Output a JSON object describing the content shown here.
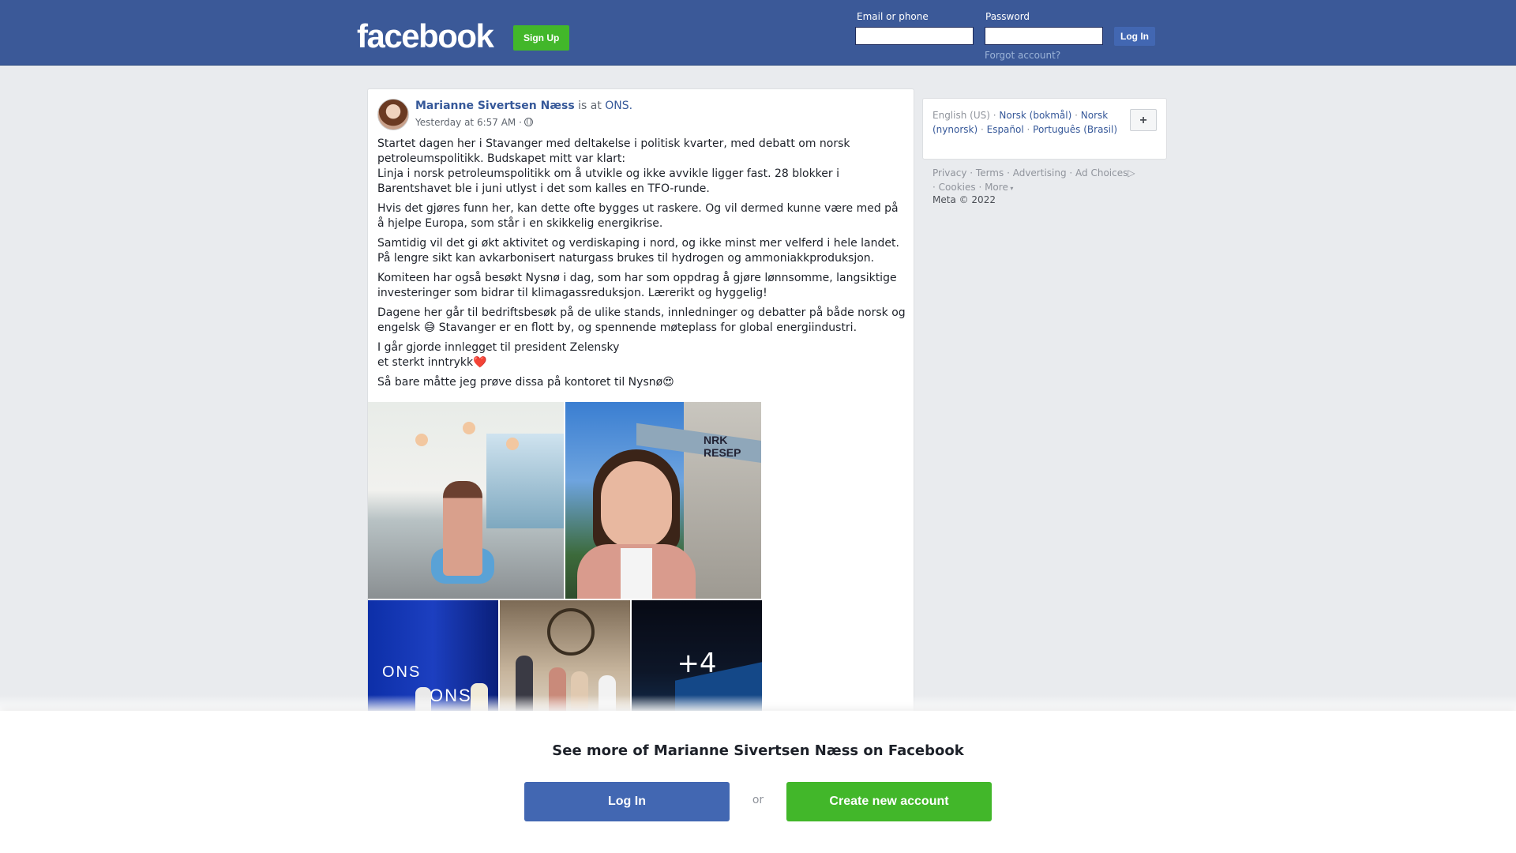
{
  "header": {
    "logo": "facebook",
    "signup_label": "Sign Up",
    "email_label": "Email or phone",
    "password_label": "Password",
    "login_label": "Log In",
    "forgot_label": "Forgot account?"
  },
  "post": {
    "author": "Marianne Sivertsen Næss",
    "is_at": "is at",
    "place": "ONS.",
    "time": "Yesterday at 6:57 AM ·",
    "paragraphs": [
      "Startet dagen her i Stavanger med deltakelse i politisk kvarter, med debatt om norsk petroleumspolitikk. Budskapet mitt var klart:\nLinja i norsk petroleumspolitikk om å utvikle og ikke avvikle ligger fast. 28 blokker i Barentshavet ble i juni utlyst i det som kalles en TFO-runde.",
      "Hvis det gjøres funn her, kan dette ofte bygges ut raskere. Og vil dermed kunne være med på å hjelpe Europa, som står i en skikkelig energikrise.",
      "Samtidig vil det gi økt aktivitet og verdiskaping i nord, og ikke minst mer velferd i hele landet. På lengre sikt kan avkarbonisert naturgass brukes til hydrogen og ammoniakkproduksjon.",
      "Komiteen har også besøkt Nysnø i dag, som har som oppdrag å gjøre lønnsomme, langsiktige investeringer som bidrar til klimagassreduksjon. Lærerikt og hyggelig!",
      "Dagene her går til bedriftsbesøk på de ulike stands, innledninger og debatter på både norsk og engelsk 😅 Stavanger er en flott by, og spennende møteplass for global energiindustri.",
      "I går gjorde innlegget til president Zelensky\net sterkt inntrykk❤️",
      "Så bare måtte jeg prøve dissa på kontoret til Nysnø😍"
    ],
    "photo_more": "+4",
    "photo_signs": {
      "nrk": "NRK RESEP",
      "ons": "ONS"
    }
  },
  "sidebar": {
    "languages": [
      "English (US)",
      "Norsk (bokmål)",
      "Norsk (nynorsk)",
      "Español",
      "Português (Brasil)"
    ],
    "add_language": "+",
    "footer_links": [
      "Privacy",
      "Terms",
      "Advertising",
      "Ad Choices",
      "Cookies",
      "More"
    ],
    "copyright": "Meta © 2022"
  },
  "overlay": {
    "title": "See more of Marianne Sivertsen Næss on Facebook",
    "login_label": "Log In",
    "or_label": "or",
    "create_label": "Create new account"
  },
  "colors": {
    "brand_blue": "#3b5998",
    "button_blue": "#4267b2",
    "green": "#42b72a",
    "link": "#365899"
  }
}
